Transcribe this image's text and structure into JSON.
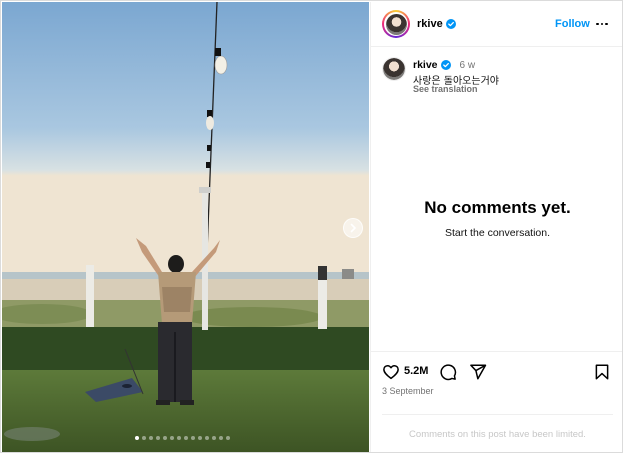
{
  "post": {
    "carousel": {
      "slide_count": 14,
      "active_index": 0
    },
    "header": {
      "username": "rkive",
      "verified": true,
      "follow_label": "Follow",
      "more_icon": "more-horizontal-icon"
    },
    "caption": {
      "username": "rkive",
      "time_ago": "6 w",
      "text": "사랑은 돌아오는거야",
      "translate_label": "See translation"
    },
    "comments": {
      "empty_title": "No comments yet.",
      "empty_subtitle": "Start the conversation."
    },
    "actions": {
      "like_icon": "heart-icon",
      "like_count": "5.2M",
      "comment_icon": "comment-icon",
      "share_icon": "send-icon",
      "save_icon": "bookmark-icon"
    },
    "date": "3 September",
    "limited_notice": "Comments on this post have been limited.",
    "colors": {
      "accent": "#0095f6",
      "muted": "#737373",
      "disabled": "#c7c7c7"
    }
  }
}
